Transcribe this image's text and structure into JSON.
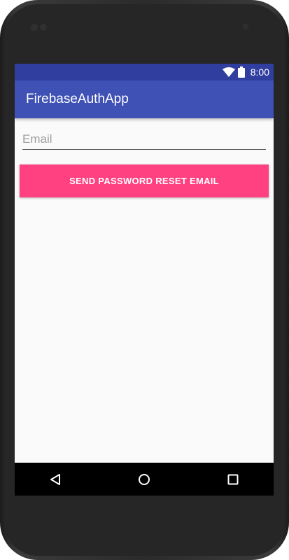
{
  "status_bar": {
    "time": "8:00",
    "icons": [
      "wifi-icon",
      "battery-icon"
    ]
  },
  "app_bar": {
    "title": "FirebaseAuthApp"
  },
  "form": {
    "email_placeholder": "Email",
    "email_value": "",
    "reset_button_label": "SEND PASSWORD RESET EMAIL"
  },
  "nav_bar": {
    "icons": [
      "back-icon",
      "home-icon",
      "recents-icon"
    ]
  },
  "colors": {
    "status_bar": "#303f9f",
    "app_bar": "#3f51b5",
    "accent": "#ff4081",
    "background": "#fafafa"
  }
}
